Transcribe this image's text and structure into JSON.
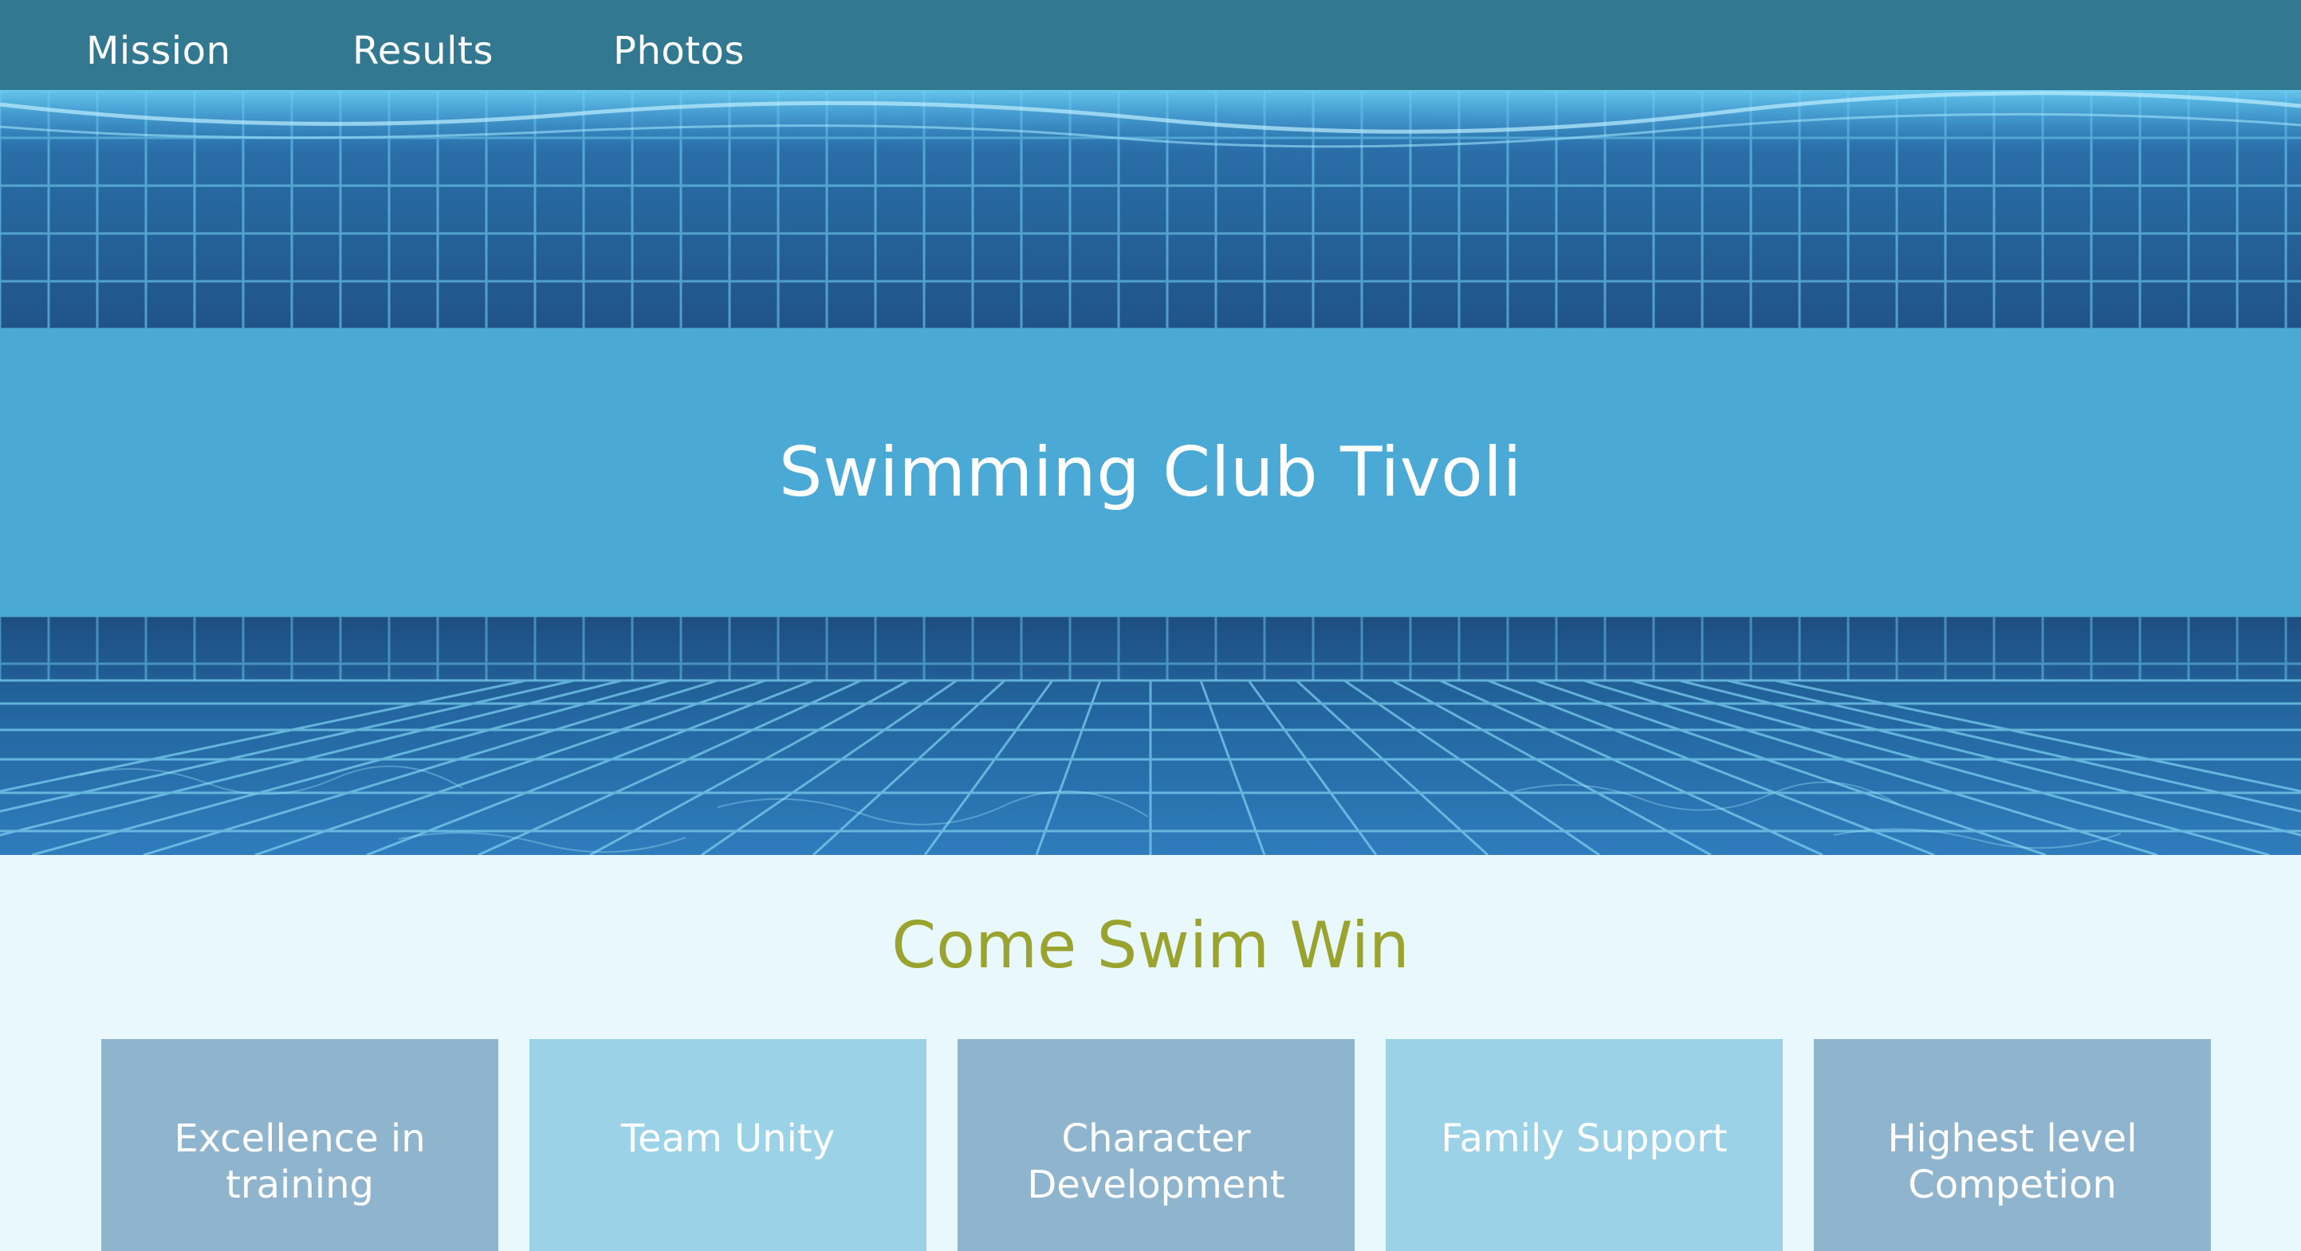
{
  "nav": {
    "items": [
      {
        "label": "Mission"
      },
      {
        "label": "Results"
      },
      {
        "label": "Photos"
      }
    ]
  },
  "hero": {
    "title": "Swimming Club Tivoli"
  },
  "main": {
    "tagline": "Come Swim Win",
    "cards": [
      {
        "label": "Excellence in\ntraining"
      },
      {
        "label": "Team Unity"
      },
      {
        "label": "Character\nDevelopment"
      },
      {
        "label": "Family Support"
      },
      {
        "label": "Highest level\nCompetion"
      }
    ]
  },
  "colors": {
    "nav_bg": "#337891",
    "banner_bg": "#4ba9d5",
    "page_bg": "#e8f8fd",
    "tagline": "#9aa32e",
    "card_dark": "#8fb4cd",
    "card_light": "#9cd2e8",
    "water_deep": "#1d4f80",
    "tile_line": "#7fd4f3"
  }
}
